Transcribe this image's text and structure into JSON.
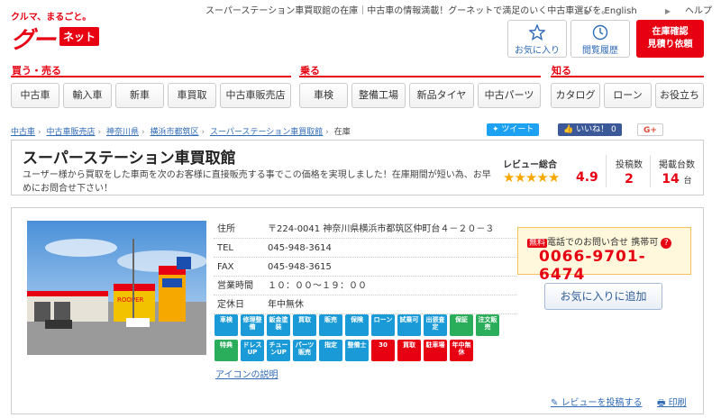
{
  "header": {
    "logo_tagline": "クルマ、まるごと。",
    "logo_text": "グー",
    "logo_net": "ネット",
    "tagline": "スーパーステーション車買取館の在庫｜中古車の情報満載！グーネットで満足のいく中古車選びを。",
    "links": {
      "english": "English",
      "help": "ヘルプ"
    },
    "buttons": {
      "favorite": "お気に入り",
      "history": "閲覧履歴",
      "inquiry_line1": "在庫確認",
      "inquiry_line2": "見積り依頼"
    }
  },
  "nav": {
    "groups": [
      {
        "label": "買う・売る",
        "items": [
          "中古車",
          "輸入車",
          "新車",
          "車買取",
          "中古車販売店"
        ]
      },
      {
        "label": "乗る",
        "items": [
          "車検",
          "整備工場",
          "新品タイヤ",
          "中古パーツ"
        ]
      },
      {
        "label": "知る",
        "items": [
          "カタログ",
          "ローン",
          "お役立ち"
        ]
      }
    ]
  },
  "breadcrumb": [
    "中古車",
    "中古車販売店",
    "神奈川県",
    "横浜市都筑区",
    "スーパーステーション車買取館",
    "在庫"
  ],
  "social": {
    "tweet": "ツイート",
    "like": "いいね！",
    "like_count": "0",
    "gplus": "G+"
  },
  "colors": {
    "brand_red": "#e60012",
    "twitter": "#1da1f2",
    "facebook": "#3b5998",
    "link": "#2f6bb7"
  },
  "shop": {
    "name": "スーパーステーション車買取館",
    "description": "ユーザー様から買取をした車両を次のお客様に直接販売する事でこの価格を実現しました！在庫期間が短い為、お早めにお問合せ下さい！",
    "review_label": "レビュー総合",
    "rating": 4.9,
    "rating_text": "4.9",
    "posts_label": "投稿数",
    "posts": "2",
    "stock_label": "掲載台数",
    "stock": "14",
    "stock_unit": "台"
  },
  "info": [
    {
      "key": "住所",
      "value": "〒224-0041 神奈川県横浜市都筑区仲町台４－２０－３"
    },
    {
      "key": "TEL",
      "value": "045-948-3614"
    },
    {
      "key": "FAX",
      "value": "045-948-3615"
    },
    {
      "key": "営業時間",
      "value": "１０：００～１９：００"
    },
    {
      "key": "定休日",
      "value": "年中無休"
    }
  ],
  "photo_sign": "ROOPER",
  "icons": [
    {
      "name": "syaken-icon",
      "label": "車検",
      "color": "#1a9bd7"
    },
    {
      "name": "seibi-icon",
      "label": "修理整備",
      "color": "#1a9bd7"
    },
    {
      "name": "bankin-icon",
      "label": "鈑金塗装",
      "color": "#1a9bd7"
    },
    {
      "name": "kaitori-icon",
      "label": "買取",
      "color": "#1a9bd7"
    },
    {
      "name": "sell-icon",
      "label": "販売",
      "color": "#1a9bd7"
    },
    {
      "name": "hoken-icon",
      "label": "保険",
      "color": "#1a9bd7"
    },
    {
      "name": "loan-icon",
      "label": "ローン",
      "color": "#1a9bd7"
    },
    {
      "name": "shijo-icon",
      "label": "試乗可",
      "color": "#1a9bd7"
    },
    {
      "name": "shuccho-icon",
      "label": "出張査定",
      "color": "#1a9bd7"
    },
    {
      "name": "hosho-icon",
      "label": "保証",
      "color": "#2bae5c"
    },
    {
      "name": "chumon-icon",
      "label": "注文販売",
      "color": "#2bae5c"
    },
    {
      "name": "tokuten-icon",
      "label": "特典",
      "color": "#2bae5c"
    },
    {
      "name": "dress-up-icon",
      "label": "ドレスUP",
      "color": "#1a9bd7"
    },
    {
      "name": "tune-up-icon",
      "label": "チューンUP",
      "color": "#1a9bd7"
    },
    {
      "name": "parts-icon",
      "label": "パーツ販売",
      "color": "#1a9bd7"
    },
    {
      "name": "shitei-icon",
      "label": "指定",
      "color": "#1a9bd7"
    },
    {
      "name": "seibishi-icon",
      "label": "整備士",
      "color": "#1a9bd7"
    },
    {
      "name": "thirty-icon",
      "label": "30",
      "color": "#e60012"
    },
    {
      "name": "kaitori2-icon",
      "label": "買取",
      "color": "#e60012"
    },
    {
      "name": "parking-icon",
      "label": "駐車場",
      "color": "#e60012"
    },
    {
      "name": "nenchu-icon",
      "label": "年中無休",
      "color": "#e60012"
    }
  ],
  "icon_link": "アイコンの説明",
  "contact": {
    "free_badge": "無料",
    "call_label": "電話でのお問い合せ 携帯可",
    "help": "?",
    "phone": "0066-9701-6474"
  },
  "favorite_add": "お気に入りに追加",
  "footer_links": {
    "review": "レビューを投稿する",
    "print": "印刷"
  }
}
